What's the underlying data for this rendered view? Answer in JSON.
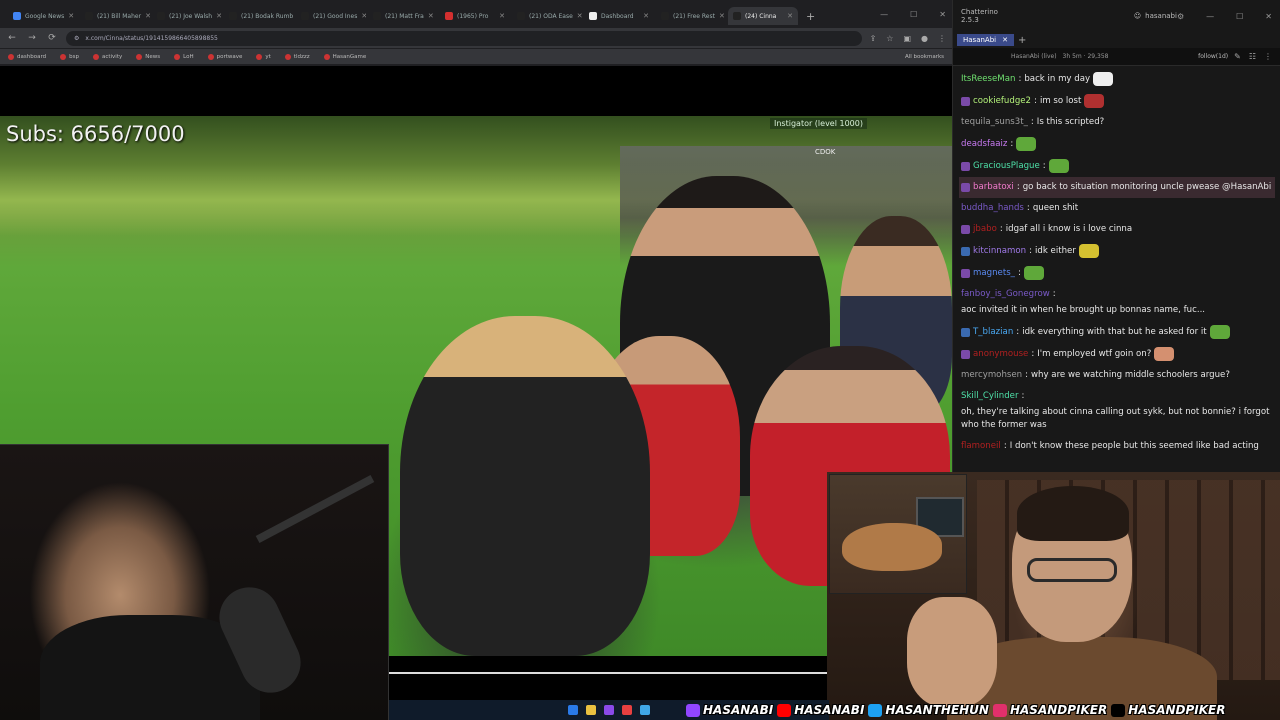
{
  "browser": {
    "tabs": [
      {
        "label": "Google News",
        "icon": "google-icon",
        "color": "#4285f4"
      },
      {
        "label": "(21) Bill Maher",
        "icon": "x-icon",
        "color": "#222222"
      },
      {
        "label": "(21) Joe Walsh",
        "icon": "x-icon",
        "color": "#222222"
      },
      {
        "label": "(21) Bodak Rumb",
        "icon": "x-icon",
        "color": "#222222"
      },
      {
        "label": "(21) Good Ines",
        "icon": "x-icon",
        "color": "#222222"
      },
      {
        "label": "(21) Matt Fra",
        "icon": "x-icon",
        "color": "#222222"
      },
      {
        "label": "(1965) Pro",
        "icon": "youtube-icon",
        "color": "#d32f2f"
      },
      {
        "label": "(21) ODA Ease",
        "icon": "x-icon",
        "color": "#222222"
      },
      {
        "label": "Dashboard",
        "icon": "dashboard-icon",
        "color": "#eeeeee"
      },
      {
        "label": "(21) Free Rest",
        "icon": "x-icon",
        "color": "#222222"
      },
      {
        "label": "(24) Cinna",
        "icon": "x-icon",
        "color": "#222222",
        "active": true
      }
    ],
    "url": "x.com/Cinna/status/1914159866405898855",
    "bookmarks": [
      "dashboard",
      "bsp",
      "activity",
      "News",
      "LoH",
      "portwave",
      "yt",
      "tldzzz",
      "HasanGame"
    ],
    "all_bookmarks": "All bookmarks"
  },
  "video": {
    "subs_text": "Subs: 6656/7000",
    "overlay_tag": "Instigator (level 1000)",
    "overlay_sub": "CDOK"
  },
  "chat": {
    "app_title": "Chatterino 2.5.3",
    "user": "hasanabi",
    "tab_label": "HasanAbi",
    "header_channel": "HasanAbi (live)",
    "header_stream": "3h 5m · 29,358",
    "header_follow": "follow(1d)",
    "messages": [
      {
        "user": "ItsReeseMan",
        "color": "#6fe06f",
        "text": "back in my day",
        "badge": "",
        "emote_color": "#eeeeee"
      },
      {
        "user": "cookiefudge2",
        "color": "#b4f27a",
        "text": "im so lost",
        "badge": "#7a4aa8",
        "emote_color": "#b03030"
      },
      {
        "user": "tequila_suns3t_",
        "color": "#a0a0a0",
        "text": "Is this scripted?",
        "badge": ""
      },
      {
        "user": "deadsfaaiz",
        "color": "#c87af2",
        "text": "",
        "badge": "",
        "emote_color": "#5fa83a"
      },
      {
        "user": "GraciousPlague",
        "color": "#4ee0a8",
        "text": "",
        "badge": "#7a4aa8",
        "emote_color": "#5fa83a"
      },
      {
        "user": "barbatoxi",
        "color": "#f07acb",
        "text": "go back to situation monitoring uncle pwease @HasanAbi",
        "badge": "#7a4aa8",
        "highlight": true
      },
      {
        "user": "buddha_hands",
        "color": "#7a5ac8",
        "text": "queen shit",
        "badge": ""
      },
      {
        "user": "jbabo",
        "color": "#b02020",
        "text": "idgaf all i know is i love cinna",
        "badge": "#7a4aa8"
      },
      {
        "user": "kitcinnamon",
        "color": "#a07ae8",
        "text": "idk either",
        "badge": "#3a6ab0",
        "emote_color": "#d4c030"
      },
      {
        "user": "magnets_",
        "color": "#5a8af2",
        "text": "",
        "badge": "#7a4aa8",
        "emote_color": "#5fa83a"
      },
      {
        "user": "fanboy_is_Gonegrow",
        "color": "#7a5ac8",
        "text": "aoc invited it in when he brought up bonnas name, fuc...",
        "badge": ""
      },
      {
        "user": "T_blazian",
        "color": "#4aa8f2",
        "text": "idk everything with that but he asked for it",
        "badge": "#3a6ab0",
        "emote_color": "#5fa83a"
      },
      {
        "user": "anonymouse",
        "color": "#b02020",
        "text": "I'm employed wtf goin on?",
        "badge": "#7a4aa8",
        "emote_color": "#d49070"
      },
      {
        "user": "mercymohsen",
        "color": "#a0a0a0",
        "text": "why are we watching middle schoolers argue?",
        "badge": ""
      },
      {
        "user": "Skill_Cylinder",
        "color": "#4ee0a8",
        "text": "oh, they're talking about cinna calling out sykk, but not bonnie? i forgot who the former was",
        "badge": ""
      },
      {
        "user": "flamoneil",
        "color": "#b02020",
        "text": "I don't know these people but this seemed like bad acting",
        "badge": ""
      }
    ]
  },
  "socials": [
    {
      "platform": "twitch",
      "handle": "HASANABI",
      "color": "#9146ff",
      "icon": "twitch-icon"
    },
    {
      "platform": "youtube",
      "handle": "HASANABI",
      "color": "#ff0000",
      "icon": "youtube-icon"
    },
    {
      "platform": "twitter",
      "handle": "HASANTHEHUN",
      "color": "#1da1f2",
      "icon": "twitter-icon"
    },
    {
      "platform": "instagram",
      "handle": "HASANDPIKER",
      "color": "#e1306c",
      "icon": "instagram-icon"
    },
    {
      "platform": "tiktok",
      "handle": "HASANDPIKER",
      "color": "#000000",
      "icon": "tiktok-icon"
    }
  ]
}
